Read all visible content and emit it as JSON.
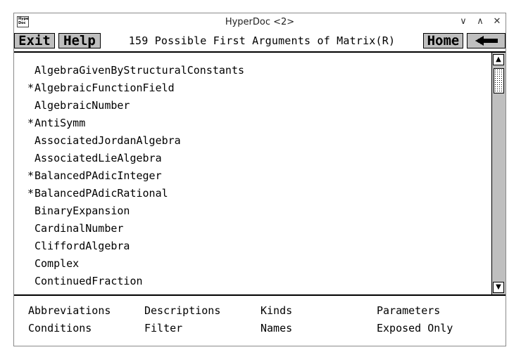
{
  "window": {
    "title": "HyperDoc <2>",
    "app_icon_text": "Hyper Doc",
    "controls": {
      "minimize": "∨",
      "maximize": "∧",
      "close": "✕"
    }
  },
  "toolbar": {
    "exit_label": "Exit",
    "help_label": "Help",
    "title": "159 Possible First Arguments of Matrix(R)",
    "home_label": "Home",
    "back_icon": "back-arrow-icon"
  },
  "items": [
    {
      "star": "",
      "label": "AlgebraGivenByStructuralConstants"
    },
    {
      "star": "*",
      "label": "AlgebraicFunctionField"
    },
    {
      "star": "",
      "label": "AlgebraicNumber"
    },
    {
      "star": "*",
      "label": "AntiSymm"
    },
    {
      "star": "",
      "label": "AssociatedJordanAlgebra"
    },
    {
      "star": "",
      "label": "AssociatedLieAlgebra"
    },
    {
      "star": "*",
      "label": "BalancedPAdicInteger"
    },
    {
      "star": "*",
      "label": "BalancedPAdicRational"
    },
    {
      "star": "",
      "label": "BinaryExpansion"
    },
    {
      "star": "",
      "label": "CardinalNumber"
    },
    {
      "star": "",
      "label": "CliffordAlgebra"
    },
    {
      "star": "",
      "label": "Complex"
    },
    {
      "star": "",
      "label": "ContinuedFraction"
    }
  ],
  "scrollbar": {
    "up": "▲",
    "down": "▼"
  },
  "bottom": {
    "abbreviations": "Abbreviations",
    "descriptions": "Descriptions",
    "kinds": "Kinds",
    "parameters": "Parameters",
    "conditions": "Conditions",
    "filter": "Filter",
    "names": "Names",
    "exposed_only": "Exposed Only"
  }
}
